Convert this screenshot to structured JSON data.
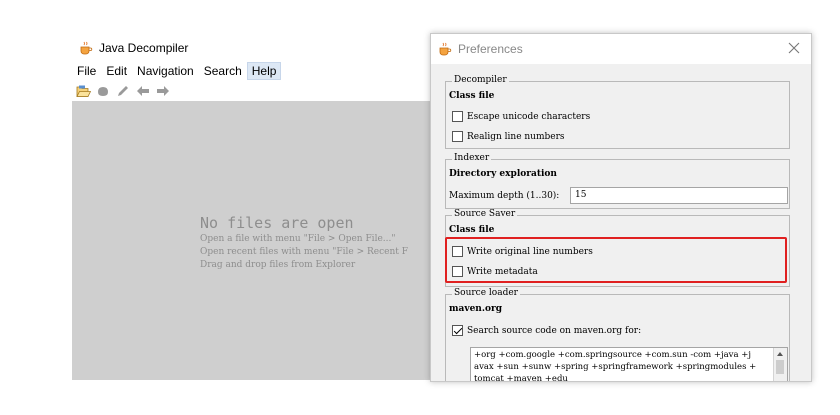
{
  "main_window": {
    "title": "Java Decompiler",
    "menu": [
      "File",
      "Edit",
      "Navigation",
      "Search",
      "Help"
    ],
    "active_menu": "Help",
    "empty_state": {
      "title": "No files are open",
      "lines": [
        "Open a file with menu \"File > Open File...\"",
        "Open recent files with menu \"File > Recent F",
        "Drag and drop files from Explorer"
      ]
    }
  },
  "preferences": {
    "title": "Preferences",
    "decompiler": {
      "legend": "Decompiler",
      "subtitle": "Class file",
      "escape_unicode": {
        "label": "Escape unicode characters",
        "checked": false
      },
      "realign_lines": {
        "label": "Realign line numbers",
        "checked": false
      }
    },
    "indexer": {
      "legend": "Indexer",
      "subtitle": "Directory exploration",
      "max_depth_label": "Maximum depth (1..30):",
      "max_depth_value": "15"
    },
    "source_saver": {
      "legend": "Source Saver",
      "subtitle": "Class file",
      "write_original_lines": {
        "label": "Write original line numbers",
        "checked": false
      },
      "write_metadata": {
        "label": "Write metadata",
        "checked": false
      }
    },
    "source_loader": {
      "legend": "Source loader",
      "subtitle": "maven.org",
      "search_maven": {
        "label": "Search source code on maven.org for:",
        "checked": true
      },
      "filters_lines": [
        "+org +com.google +com.springsource +com.sun -com +java +j",
        "avax +sun +sunw +spring +springframework +springmodules +",
        "tomcat +maven +edu"
      ]
    }
  },
  "colors": {
    "highlight": "#e02020",
    "content_bg": "#cfcfcf",
    "empty_text": "#8e8e8e"
  }
}
